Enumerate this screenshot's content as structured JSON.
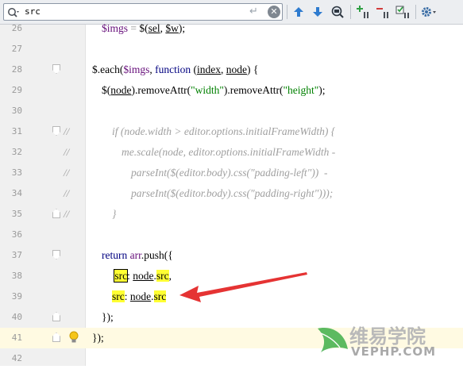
{
  "search": {
    "query": "src",
    "enter_icon": "enter-icon",
    "clear_icon": "clear-icon"
  },
  "toolbar": {
    "icons": [
      "previous-occurrence-icon",
      "next-occurrence-icon",
      "find-usages-icon",
      "add-selection-icon",
      "remove-selection-icon",
      "select-all-icon",
      "settings-icon"
    ]
  },
  "colors": {
    "keyword": "#000080",
    "string": "#008000",
    "variable": "#660e7a",
    "comment": "#9e9e9e",
    "match_highlight": "#ffff33",
    "current_line": "#fffae2"
  },
  "lines": [
    {
      "n": "26",
      "text": "$imgs = $(sel, $w);"
    },
    {
      "n": "27",
      "text": ""
    },
    {
      "n": "28",
      "text": "$.each($imgs, function (index, node) {"
    },
    {
      "n": "29",
      "text": "$(node).removeAttr(\"width\").removeAttr(\"height\");"
    },
    {
      "n": "30",
      "text": ""
    },
    {
      "n": "31",
      "comment": "//",
      "text": "if (node.width > editor.options.initialFrameWidth) {"
    },
    {
      "n": "32",
      "comment": "//",
      "text": "me.scale(node, editor.options.initialFrameWidth -"
    },
    {
      "n": "33",
      "comment": "//",
      "text": "parseInt($(editor.body).css(\"padding-left\"))  -"
    },
    {
      "n": "34",
      "comment": "//",
      "text": "parseInt($(editor.body).css(\"padding-right\")));"
    },
    {
      "n": "35",
      "comment": "//",
      "text": "}"
    },
    {
      "n": "36",
      "text": ""
    },
    {
      "n": "37",
      "text": "return arr.push({"
    },
    {
      "n": "38",
      "text": "src: node.src,"
    },
    {
      "n": "39",
      "text": "src: node.src"
    },
    {
      "n": "40",
      "text": "});"
    },
    {
      "n": "41",
      "text": "});"
    },
    {
      "n": "42",
      "text": ""
    }
  ],
  "watermark": {
    "title": "维易学院",
    "site": "VEPHP.COM"
  }
}
